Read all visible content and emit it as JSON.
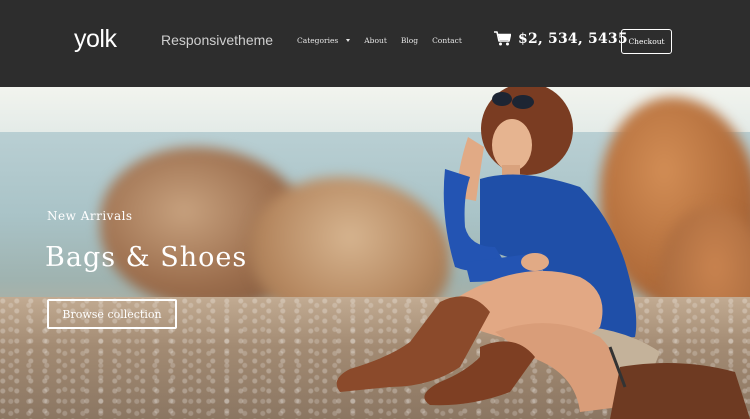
{
  "header": {
    "logo": "yolk",
    "tagline": "Responsivetheme",
    "nav": [
      {
        "label": "Categories",
        "has_dropdown": true
      },
      {
        "label": "About",
        "has_dropdown": false
      },
      {
        "label": "Blog",
        "has_dropdown": false
      },
      {
        "label": "Contact",
        "has_dropdown": false
      }
    ],
    "cart_icon": "shopping-cart-icon",
    "cart_amount": "$2, 534, 5435",
    "checkout_label": "Checkout"
  },
  "hero": {
    "subtitle": "New Arrivals",
    "title": "Bags & Shoes",
    "button_label": "Browse collection"
  },
  "colors": {
    "header_bg": "#2d2d2d",
    "text_light": "#ffffff",
    "shirt_blue": "#1f4fa8",
    "boots_brown": "#8b4a2b"
  }
}
